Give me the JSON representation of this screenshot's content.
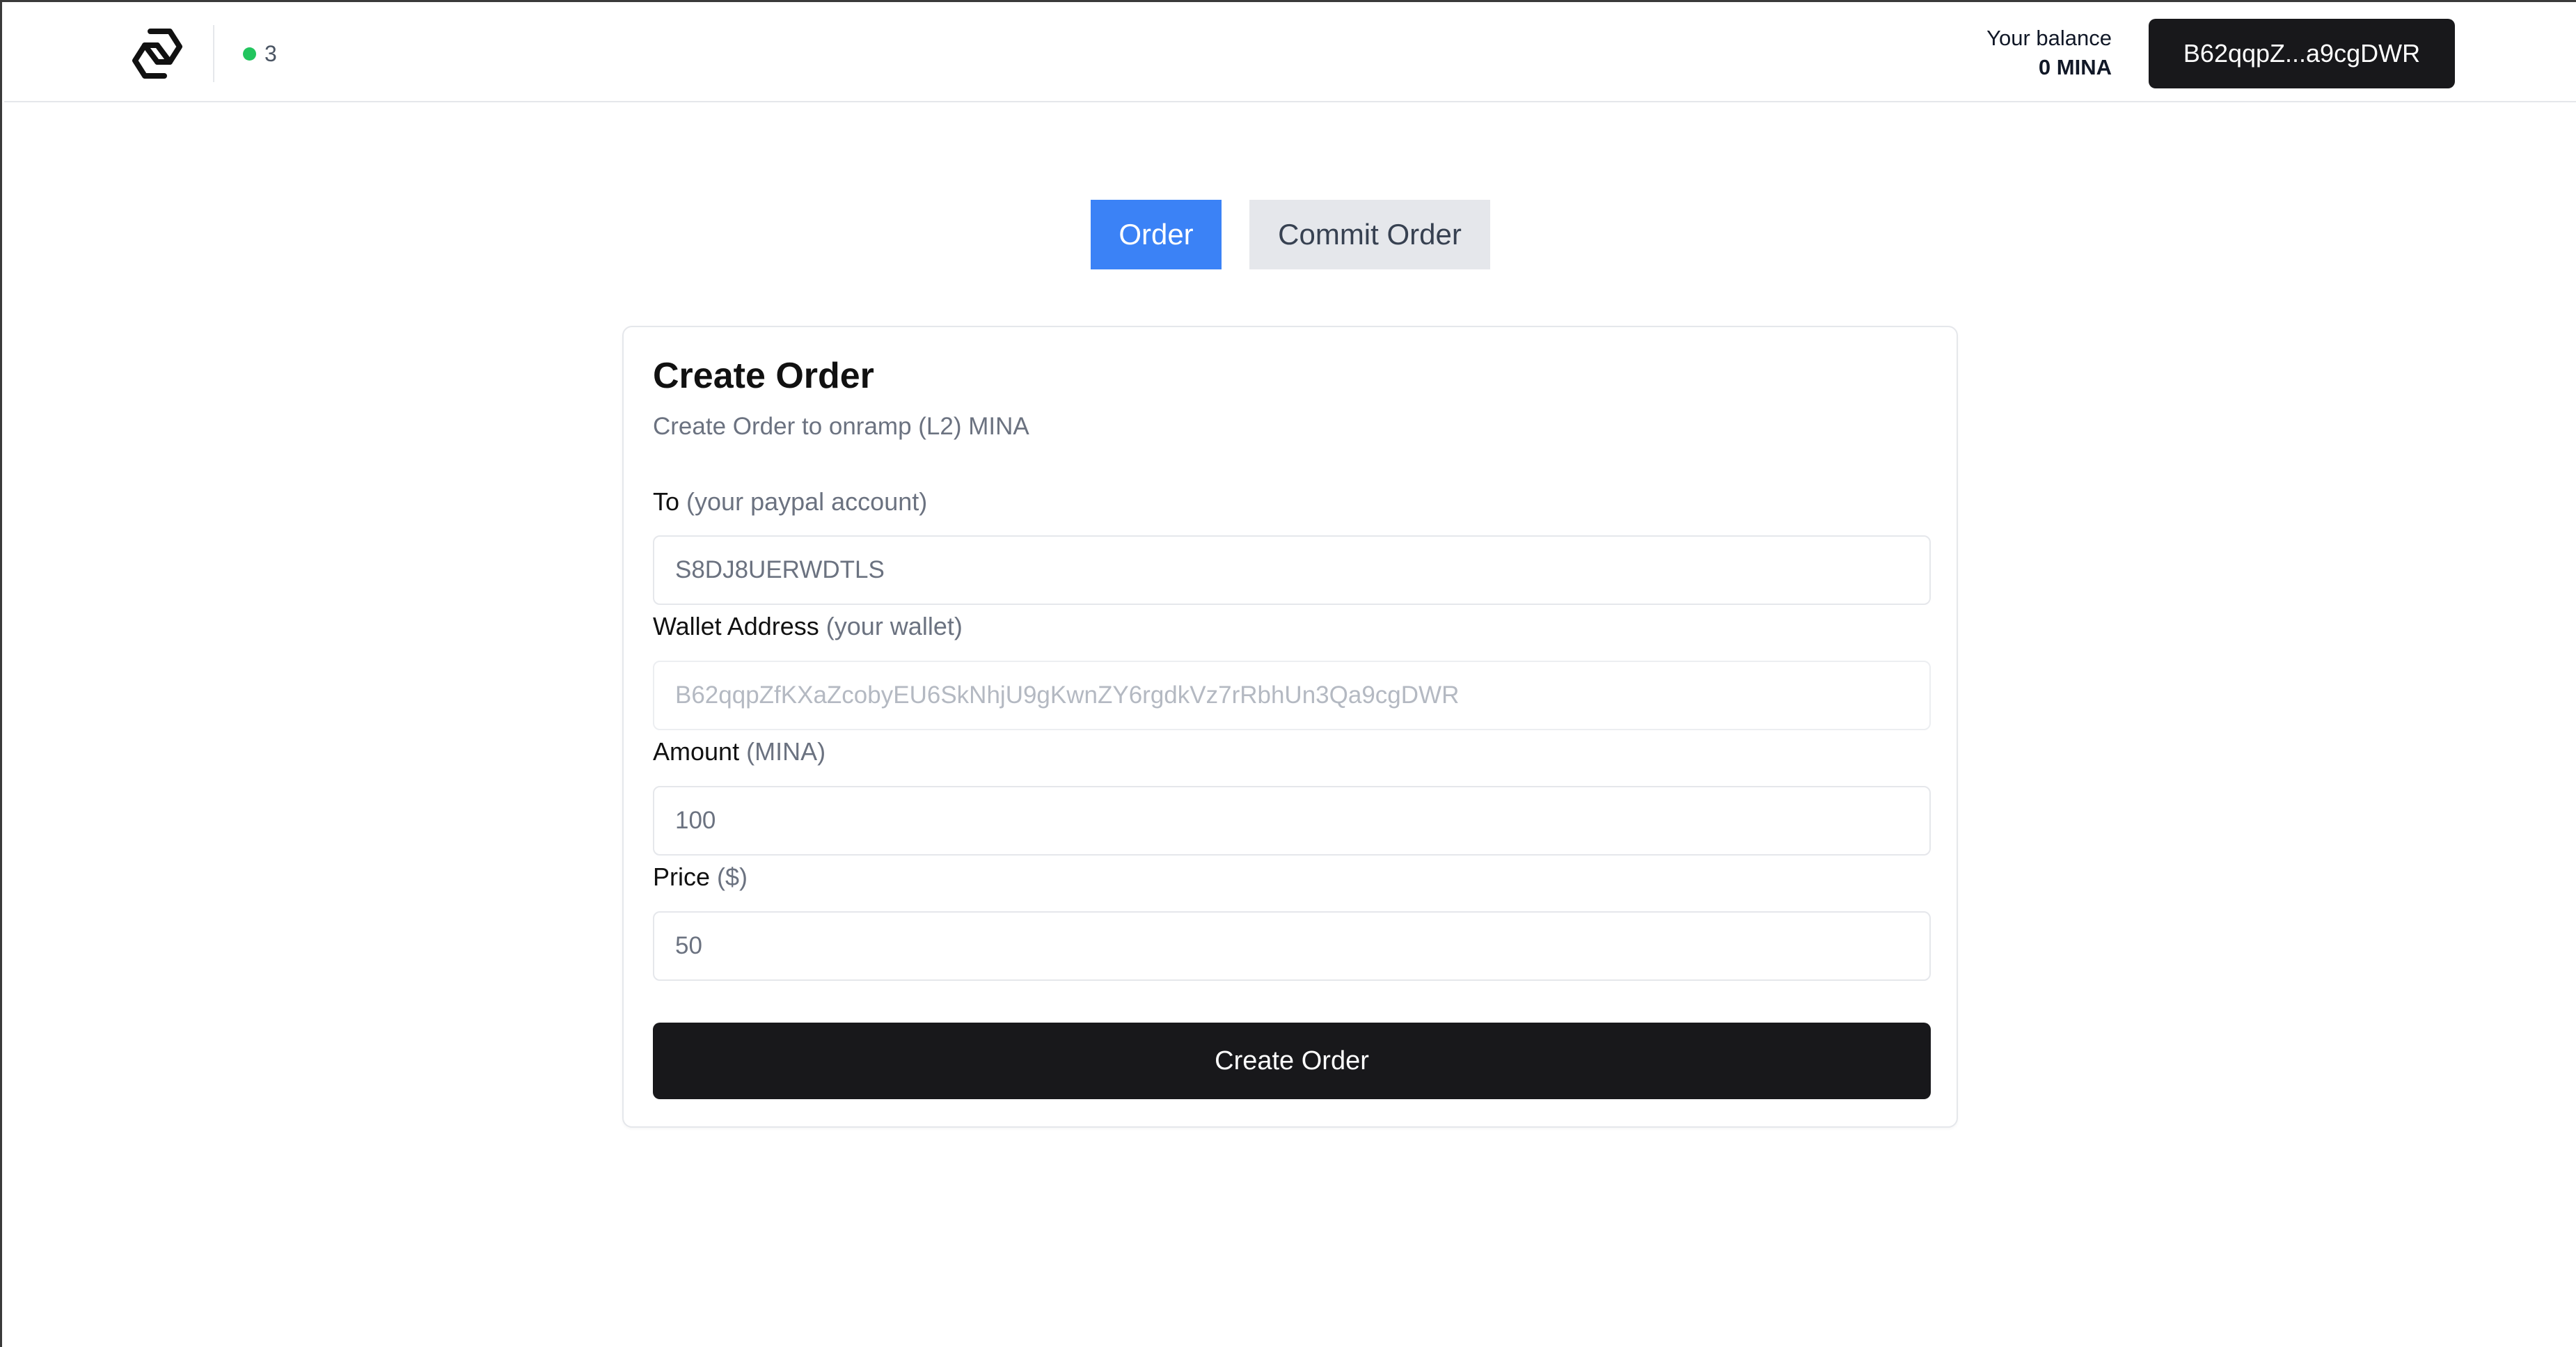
{
  "header": {
    "logo_icon": "chain-link-logo-icon",
    "block_height": "3",
    "status_color": "#22c55e",
    "balance_label": "Your balance",
    "balance_value": "0 MINA",
    "wallet_label": "B62qqpZ...a9cgDWR"
  },
  "tabs": [
    {
      "label": "Order",
      "active": true
    },
    {
      "label": "Commit Order",
      "active": false
    }
  ],
  "card": {
    "title": "Create Order",
    "subtitle": "Create Order to onramp (L2) MINA",
    "fields": {
      "to": {
        "label": "To",
        "hint": "(your paypal account)",
        "value": "S8DJ8UERWDTLS"
      },
      "wallet": {
        "label": "Wallet Address",
        "hint": "(your wallet)",
        "value": "B62qqpZfKXaZcobyEU6SkNhjU9gKwnZY6rgdkVz7rRbhUn3Qa9cgDWR"
      },
      "amount": {
        "label": "Amount",
        "hint": "(MINA)",
        "value": "100"
      },
      "price": {
        "label": "Price",
        "hint": "($)",
        "value": "50"
      }
    },
    "submit_label": "Create Order"
  },
  "colors": {
    "accent": "#3b82f6",
    "dark_button": "#18181b"
  }
}
